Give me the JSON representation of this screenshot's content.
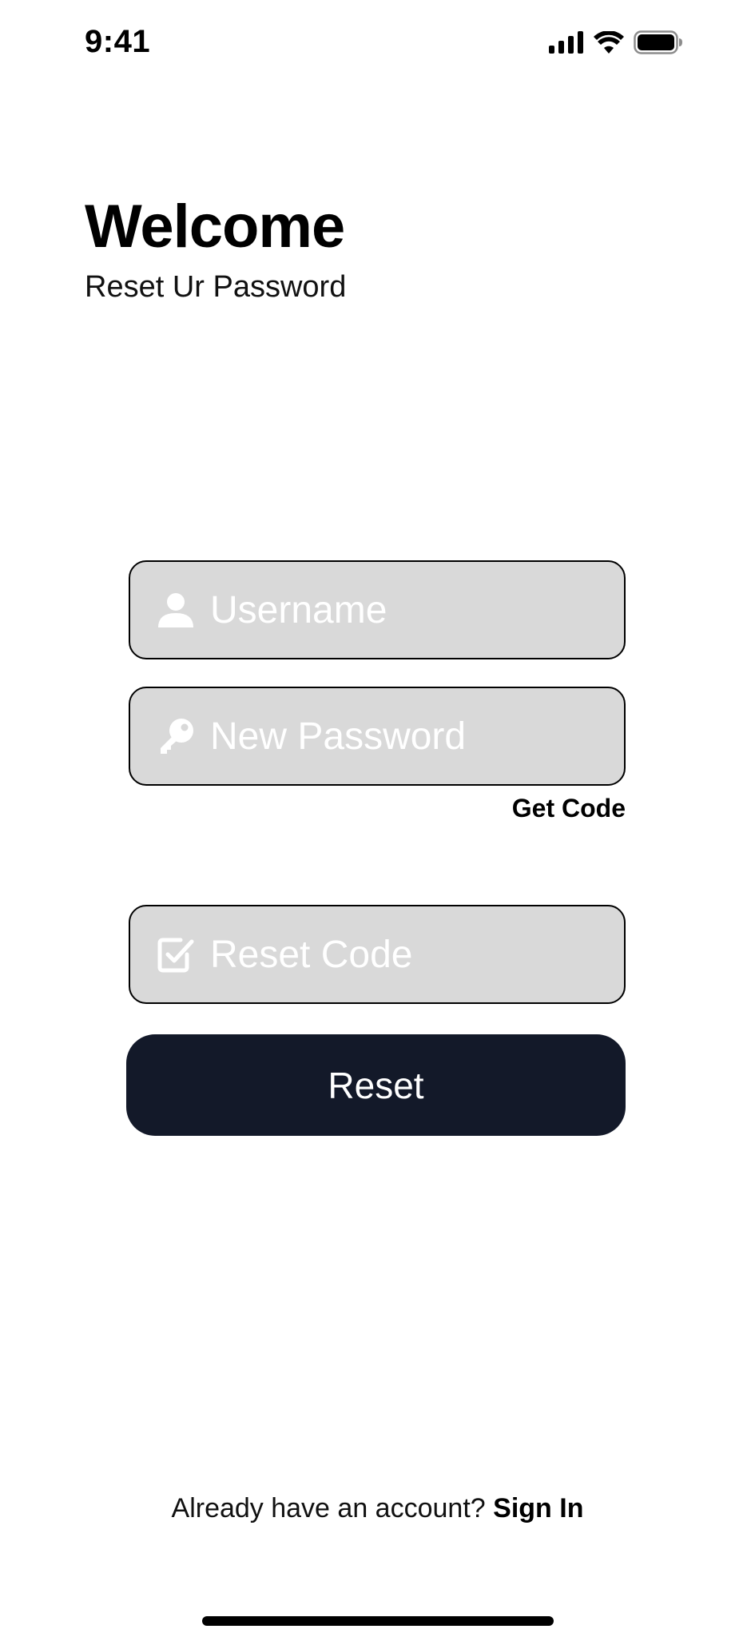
{
  "status_bar": {
    "time": "9:41",
    "icons": [
      "cellular-signal-icon",
      "wifi-icon",
      "battery-icon"
    ]
  },
  "header": {
    "title": "Welcome",
    "subtitle": "Reset Ur Password"
  },
  "form": {
    "username": {
      "placeholder": "Username",
      "value": "",
      "icon": "user-icon"
    },
    "new_password": {
      "placeholder": "New Password",
      "value": "",
      "icon": "key-icon"
    },
    "get_code_label": "Get Code",
    "reset_code": {
      "placeholder": "Reset Code",
      "value": "",
      "icon": "checkbox-icon"
    },
    "reset_button_label": "Reset"
  },
  "footer": {
    "prompt": "Already have an account?",
    "link_label": "Sign In"
  },
  "colors": {
    "field_background": "#d9d9d9",
    "button_background": "#131929",
    "placeholder_text": "#ffffff"
  }
}
